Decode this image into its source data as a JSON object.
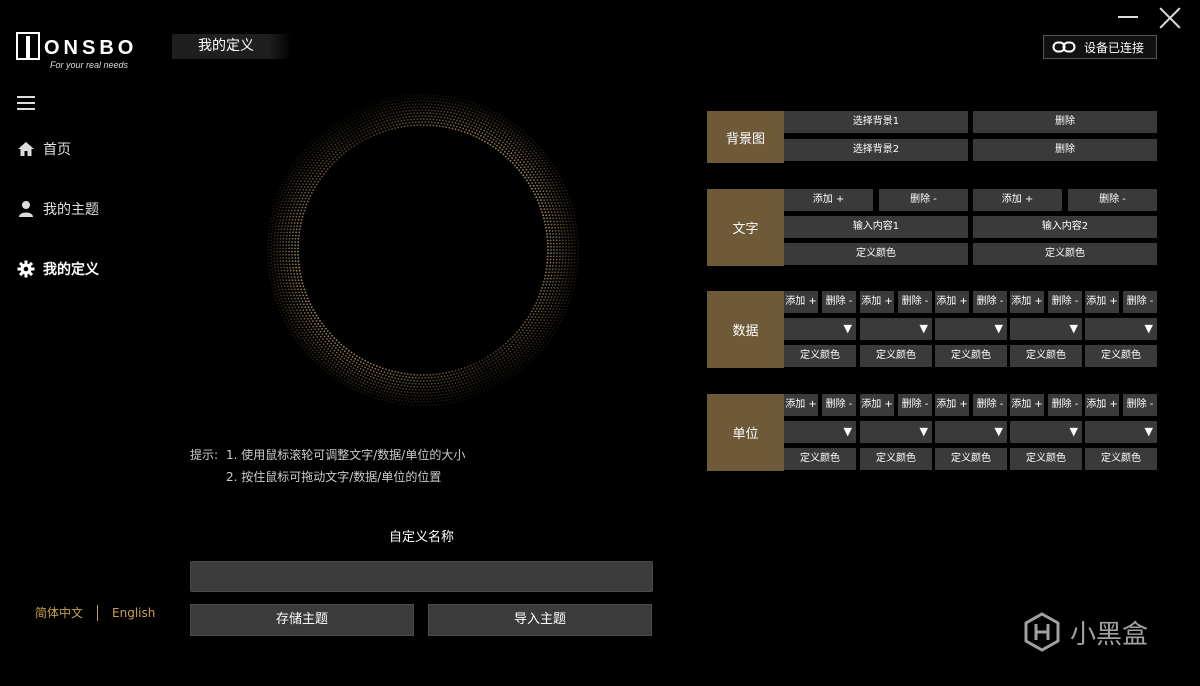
{
  "brand": {
    "logo_text": "ONSBO",
    "tagline": "For your real needs"
  },
  "page_title": "我的定义",
  "nav": {
    "items": [
      {
        "label": "首页",
        "icon": "home-icon"
      },
      {
        "label": "我的主题",
        "icon": "user-icon"
      },
      {
        "label": "我的定义",
        "icon": "gear-icon",
        "active": true
      }
    ]
  },
  "language": {
    "zh": "简体中文",
    "en": "English"
  },
  "device_status": "设备已连接",
  "tips": {
    "label": "提示:",
    "line1": "1. 使用鼠标滚轮可调整文字/数据/单位的大小",
    "line2": "2. 按住鼠标可拖动文字/数据/单位的位置"
  },
  "custom_name": {
    "label": "自定义名称",
    "value": "",
    "placeholder": ""
  },
  "actions": {
    "save": "存储主题",
    "import": "导入主题"
  },
  "panel": {
    "background": {
      "label": "背景图",
      "select1": "选择背景1",
      "select2": "选择背景2",
      "delete": "删除"
    },
    "text": {
      "label": "文字",
      "add": "添加 +",
      "remove": "删除 -",
      "input1": "输入内容1",
      "input2": "输入内容2",
      "color": "定义颜色"
    },
    "data": {
      "label": "数据",
      "add": "添加 +",
      "remove": "删除 -",
      "color": "定义颜色"
    },
    "unit": {
      "label": "单位",
      "add": "添加 +",
      "remove": "删除 -",
      "color": "定义颜色"
    }
  },
  "watermark": "小黑盒",
  "colors": {
    "accent": "#6e5a39",
    "lang": "#c9a046",
    "button": "#3a3a3a"
  }
}
